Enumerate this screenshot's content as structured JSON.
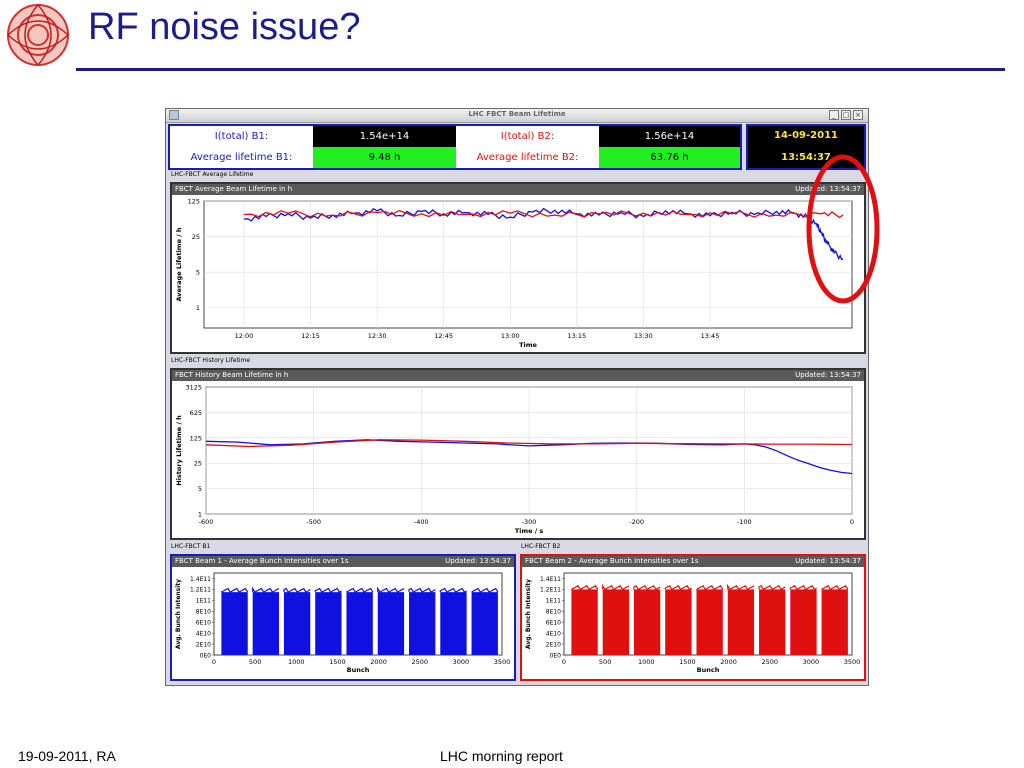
{
  "slide": {
    "title": "RF noise issue?",
    "footer_left": "19-09-2011, RA",
    "footer_center": "LHC morning report"
  },
  "window": {
    "title": "LHC FBCT Beam Lifetime",
    "buttons": [
      "_",
      "□",
      "×"
    ]
  },
  "summary": {
    "b1_total_label": "I(total) B1:",
    "b1_total_value": "1.54e+14",
    "b2_total_label": "I(total) B2:",
    "b2_total_value": "1.56e+14",
    "b1_life_label": "Average lifetime B1:",
    "b1_life_value": "9.48 h",
    "b2_life_label": "Average lifetime B2:",
    "b2_life_value": "63.76 h",
    "date": "14-09-2011",
    "time": "13:54:37"
  },
  "colors": {
    "beam1": "#1010e0",
    "beam2": "#e01010",
    "title_blue": "#1c1c8c",
    "good": "#22ee22"
  },
  "sections": {
    "avg": "LHC-FBCT Average Lifetime",
    "hist": "LHC-FBCT History Lifetime",
    "b1": "LHC-FBCT B1",
    "b2": "LHC-FBCT B2"
  },
  "chart_data": [
    {
      "type": "line",
      "title": "FBCT Average Beam Lifetime in h",
      "updated": "Updated: 13:54:37",
      "xlabel": "Time",
      "ylabel": "Average Lifetime / h",
      "yscale": "log",
      "ylim": [
        0.4,
        125
      ],
      "yticks": [
        "125",
        "25",
        "5",
        "1"
      ],
      "xticks": [
        "12:00",
        "12:15",
        "12:30",
        "12:45",
        "13:00",
        "13:15",
        "13:30",
        "13:45"
      ],
      "xlim_minutes": [
        -9,
        137
      ],
      "series": [
        {
          "color": "#1010e0",
          "x_minutes": [
            0,
            5,
            10,
            15,
            20,
            25,
            30,
            35,
            40,
            45,
            50,
            55,
            60,
            65,
            70,
            75,
            80,
            85,
            90,
            95,
            100,
            105,
            110,
            115,
            120,
            124,
            127,
            129,
            130,
            131,
            132,
            133,
            135
          ],
          "values": [
            55,
            62,
            70,
            58,
            66,
            72,
            80,
            65,
            78,
            70,
            74,
            68,
            60,
            76,
            82,
            70,
            66,
            74,
            62,
            80,
            70,
            64,
            75,
            68,
            78,
            72,
            60,
            45,
            30,
            22,
            16,
            12,
            9
          ]
        },
        {
          "color": "#e01010",
          "x_minutes": [
            0,
            10,
            20,
            30,
            40,
            50,
            60,
            70,
            80,
            90,
            100,
            110,
            120,
            130,
            135
          ],
          "values": [
            68,
            72,
            66,
            74,
            70,
            68,
            72,
            66,
            70,
            72,
            68,
            70,
            66,
            70,
            66
          ]
        }
      ]
    },
    {
      "type": "line",
      "title": "FBCT History Beam Lifetime in h",
      "updated": "Updated: 13:54:37",
      "xlabel": "Time / s",
      "ylabel": "History Lifetime / h",
      "yscale": "log",
      "ylim": [
        1,
        3125
      ],
      "yticks": [
        "3125",
        "625",
        "125",
        "25",
        "5",
        "1"
      ],
      "xticks": [
        "-600",
        "-500",
        "-400",
        "-300",
        "-200",
        "-100",
        "0"
      ],
      "xlim": [
        -600,
        0
      ],
      "series": [
        {
          "color": "#1010e0",
          "x": [
            -600,
            -570,
            -540,
            -510,
            -480,
            -450,
            -420,
            -390,
            -360,
            -330,
            -300,
            -270,
            -240,
            -210,
            -180,
            -150,
            -120,
            -100,
            -90,
            -80,
            -70,
            -60,
            -50,
            -40,
            -30,
            -20,
            -10,
            0
          ],
          "values": [
            100,
            95,
            80,
            85,
            100,
            110,
            100,
            95,
            90,
            85,
            75,
            80,
            88,
            90,
            88,
            82,
            80,
            85,
            80,
            70,
            55,
            40,
            30,
            24,
            19,
            16,
            14,
            13
          ]
        },
        {
          "color": "#e01010",
          "x": [
            -600,
            -560,
            -520,
            -480,
            -440,
            -400,
            -360,
            -320,
            -280,
            -240,
            -200,
            -160,
            -120,
            -80,
            -40,
            0
          ],
          "values": [
            80,
            72,
            78,
            95,
            110,
            108,
            100,
            90,
            85,
            85,
            88,
            86,
            85,
            84,
            84,
            82
          ]
        }
      ]
    },
    {
      "type": "bar",
      "title": "FBCT Beam 1 - Average Bunch Intensities over 1s",
      "updated": "Updated: 13:54:37",
      "xlabel": "Bunch",
      "ylabel": "Avg. Bunch Intensity",
      "ylim": [
        0,
        150000000000.0
      ],
      "yticks": [
        "1.4E11",
        "1.2E11",
        "1E11",
        "8E10",
        "6E10",
        "4E10",
        "2E10",
        "0E0"
      ],
      "xticks": [
        "0",
        "500",
        "1000",
        "1500",
        "2000",
        "2500",
        "3000",
        "3500"
      ],
      "xlim": [
        0,
        3500
      ],
      "color": "#1010e0",
      "trains": [
        [
          90,
          410
        ],
        [
          470,
          790
        ],
        [
          850,
          1170
        ],
        [
          1230,
          1550
        ],
        [
          1610,
          1930
        ],
        [
          1990,
          2310
        ],
        [
          2370,
          2690
        ],
        [
          2750,
          3070
        ],
        [
          3130,
          3450
        ]
      ],
      "level": 115000000000.0
    },
    {
      "type": "bar",
      "title": "FBCT Beam 2 - Average Bunch Intensities over 1s",
      "updated": "Updated: 13:54:37",
      "xlabel": "Bunch",
      "ylabel": "Avg. Bunch Intensity",
      "ylim": [
        0,
        150000000000.0
      ],
      "yticks": [
        "1.4E11",
        "1.2E11",
        "1E11",
        "8E10",
        "6E10",
        "4E10",
        "2E10",
        "0E0"
      ],
      "xticks": [
        "0",
        "500",
        "1000",
        "1500",
        "2000",
        "2500",
        "3000",
        "3500"
      ],
      "xlim": [
        0,
        3500
      ],
      "color": "#e01010",
      "trains": [
        [
          90,
          410
        ],
        [
          470,
          790
        ],
        [
          850,
          1170
        ],
        [
          1230,
          1550
        ],
        [
          1610,
          1930
        ],
        [
          1990,
          2310
        ],
        [
          2370,
          2690
        ],
        [
          2750,
          3070
        ],
        [
          3130,
          3450
        ]
      ],
      "level": 120000000000.0
    }
  ]
}
